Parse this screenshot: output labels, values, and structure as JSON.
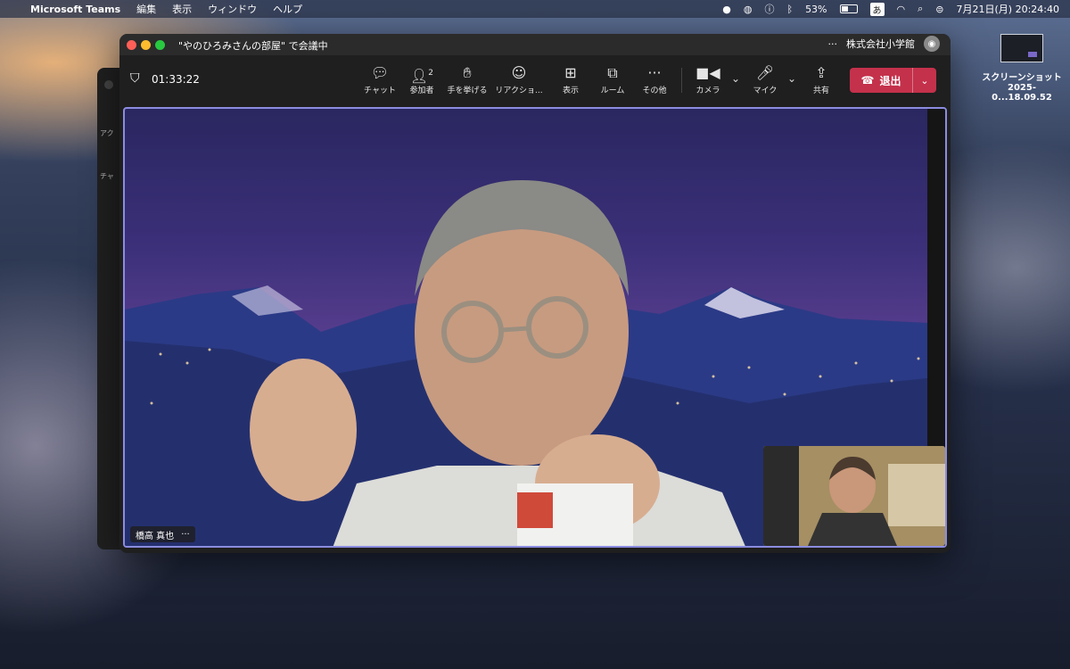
{
  "menubar": {
    "app_name": "Microsoft Teams",
    "menus": [
      "編集",
      "表示",
      "ウィンドウ",
      "ヘルプ"
    ],
    "battery_percent": "53%",
    "battery_level": 0.53,
    "ime": "あ",
    "datetime": "7月21日(月)  20:24:40"
  },
  "desktop_icon": {
    "line1": "スクリーンショット",
    "line2": "2025-0...18.09.52"
  },
  "back_window": {
    "label1": "アク",
    "label2": "チャ"
  },
  "window": {
    "title": "\"やのひろみさんの部屋\" で会議中",
    "more": "···",
    "org": "株式会社小学館"
  },
  "toolbar": {
    "timer": "01:33:22",
    "buttons": {
      "chat": "チャット",
      "participants": "参加者",
      "participants_count": "2",
      "raise_hand": "手を挙げる",
      "reaction": "リアクショ...",
      "view": "表示",
      "rooms": "ルーム",
      "more": "その他",
      "camera": "カメラ",
      "mic": "マイク",
      "share": "共有"
    },
    "leave_label": "退出"
  },
  "stage": {
    "participant_name": "橋高 真也",
    "name_more": "···"
  },
  "colors": {
    "leave": "#c4314b",
    "stage_border": "#8b8ce0"
  }
}
